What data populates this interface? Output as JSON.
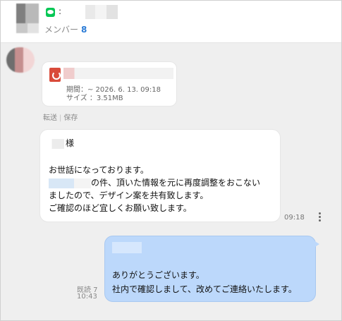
{
  "header": {
    "title_prefix": ":",
    "member_label": "メンバー",
    "member_count": "8",
    "accent_color": "#2a7bd6",
    "line_icon": "line-logo-icon"
  },
  "file_message": {
    "icon": "pdf-icon",
    "expiry": "期間：~ 2026. 6. 13. 09:18",
    "size": "サイズ ：3.51MB",
    "actions": [
      "転送",
      "保存"
    ]
  },
  "incoming_message": {
    "lines": [
      "様",
      "お世話になっております。",
      "の件、頂いた情報を元に再度調整をおこない",
      "ましたので、デザイン案を共有致します。",
      "ご確認のほど宜しくお願い致します。"
    ],
    "time": "09:18",
    "more_icon": "more-vertical-icon"
  },
  "outgoing_message": {
    "lines": [
      "ありがとうございます。",
      "社内で確認しまして、改めてご連絡いたします。"
    ],
    "read_label": "既読 7",
    "time": "10:43",
    "bubble_color": "#bcd8fb"
  }
}
